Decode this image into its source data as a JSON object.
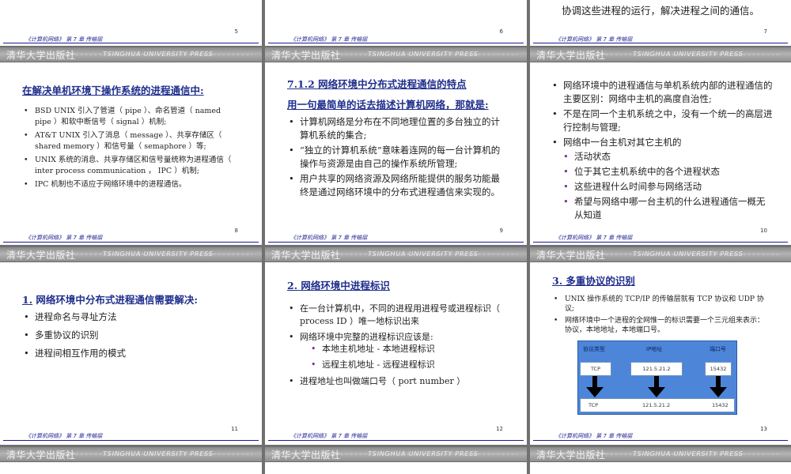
{
  "footer": "《计算机网络》 第 7 章 传输层",
  "band": {
    "cn": "清华大学出版社",
    "en": "TSINGHUA UNIVERSITY PRESS"
  },
  "pages": [
    "5",
    "6",
    "7",
    "8",
    "9",
    "10",
    "11",
    "12",
    "13"
  ],
  "slide7_top": "协调这些进程的运行，解决进程之间的通信。",
  "slide8": {
    "heading": "在解决单机环境下操作系统的进程通信中:",
    "items": [
      "BSD UNIX 引入了管道（ pipe ）、命名管道（ named pipe ）和软中断信号（ signal ）机制;",
      "AT&T UNIX 引入了消息（ message ）、共享存储区（ shared memory ）和信号量（ semaphore ）等;",
      "UNIX 系统的消息、共享存储区和信号量统称为进程通信（ inter process communication ， IPC ）机制;",
      "IPC 机制也不适应于网络环境中的进程通信。"
    ]
  },
  "slide9": {
    "heading": "7.1.2 网络环境中分布式进程通信的特点",
    "subheading": "用一句最简单的话去描述计算机网络，那就是:",
    "items": [
      "计算机网络是分布在不同地理位置的多台独立的计算机系统的集合;",
      "“独立的计算机系统”意味着连网的每一台计算机的操作与资源是由自己的操作系统所管理;",
      "用户共享的网络资源及网络所能提供的服务功能最终是通过网络环境中的分布式进程通信来实现的。"
    ]
  },
  "slide10": {
    "items": [
      "网络环境中的进程通信与单机系统内部的进程通信的主要区别：网络中主机的高度自治性;",
      "不是在同一个主机系统之中，没有一个统一的高层进行控制与管理;",
      "网络中一台主机对其它主机的"
    ],
    "subitems": [
      "活动状态",
      "位于其它主机系统中的各个进程状态",
      "这些进程什么时间参与网络活动",
      "希望与网络中哪一台主机的什么进程通信一概无从知道"
    ]
  },
  "slide11": {
    "heading_num": "1.",
    "heading_text": "网络环境中分布式进程通信需要解决:",
    "items": [
      "进程命名与寻址方法",
      "多重协议的识别",
      "进程间相互作用的模式"
    ]
  },
  "slide12": {
    "heading_num": "2.",
    "heading_text": "网络环境中进程标识",
    "items": [
      "在一台计算机中，不同的进程用进程号或进程标识（ process ID ）唯一地标识出来",
      "网络环境中完整的进程标识应该是:"
    ],
    "subitems": [
      "本地主机地址 - 本地进程标识",
      "远程主机地址 - 远程进程标识"
    ],
    "last": "进程地址也叫做端口号（ port number ）"
  },
  "slide13": {
    "heading_num": "3.",
    "heading_text": "多重协议的识别",
    "items": [
      "UNIX 操作系统的 TCP/IP 的传输层就有 TCP 协议和 UDP 协议;",
      "网络环境中一个进程的全网惟一的标识需要一个三元组来表示：协议，本地地址，本地端口号。"
    ],
    "table": {
      "headers": [
        "协议类型",
        "IP地址",
        "端口号"
      ],
      "row1": [
        "TCP",
        "121.5.21.2",
        "15432"
      ],
      "row2": [
        "TCP",
        "121.5.21.2",
        "15432"
      ]
    }
  },
  "colors": {
    "heading": "#1f2e8c",
    "footer": "#1a1a8c",
    "table": "#4d86d9"
  }
}
